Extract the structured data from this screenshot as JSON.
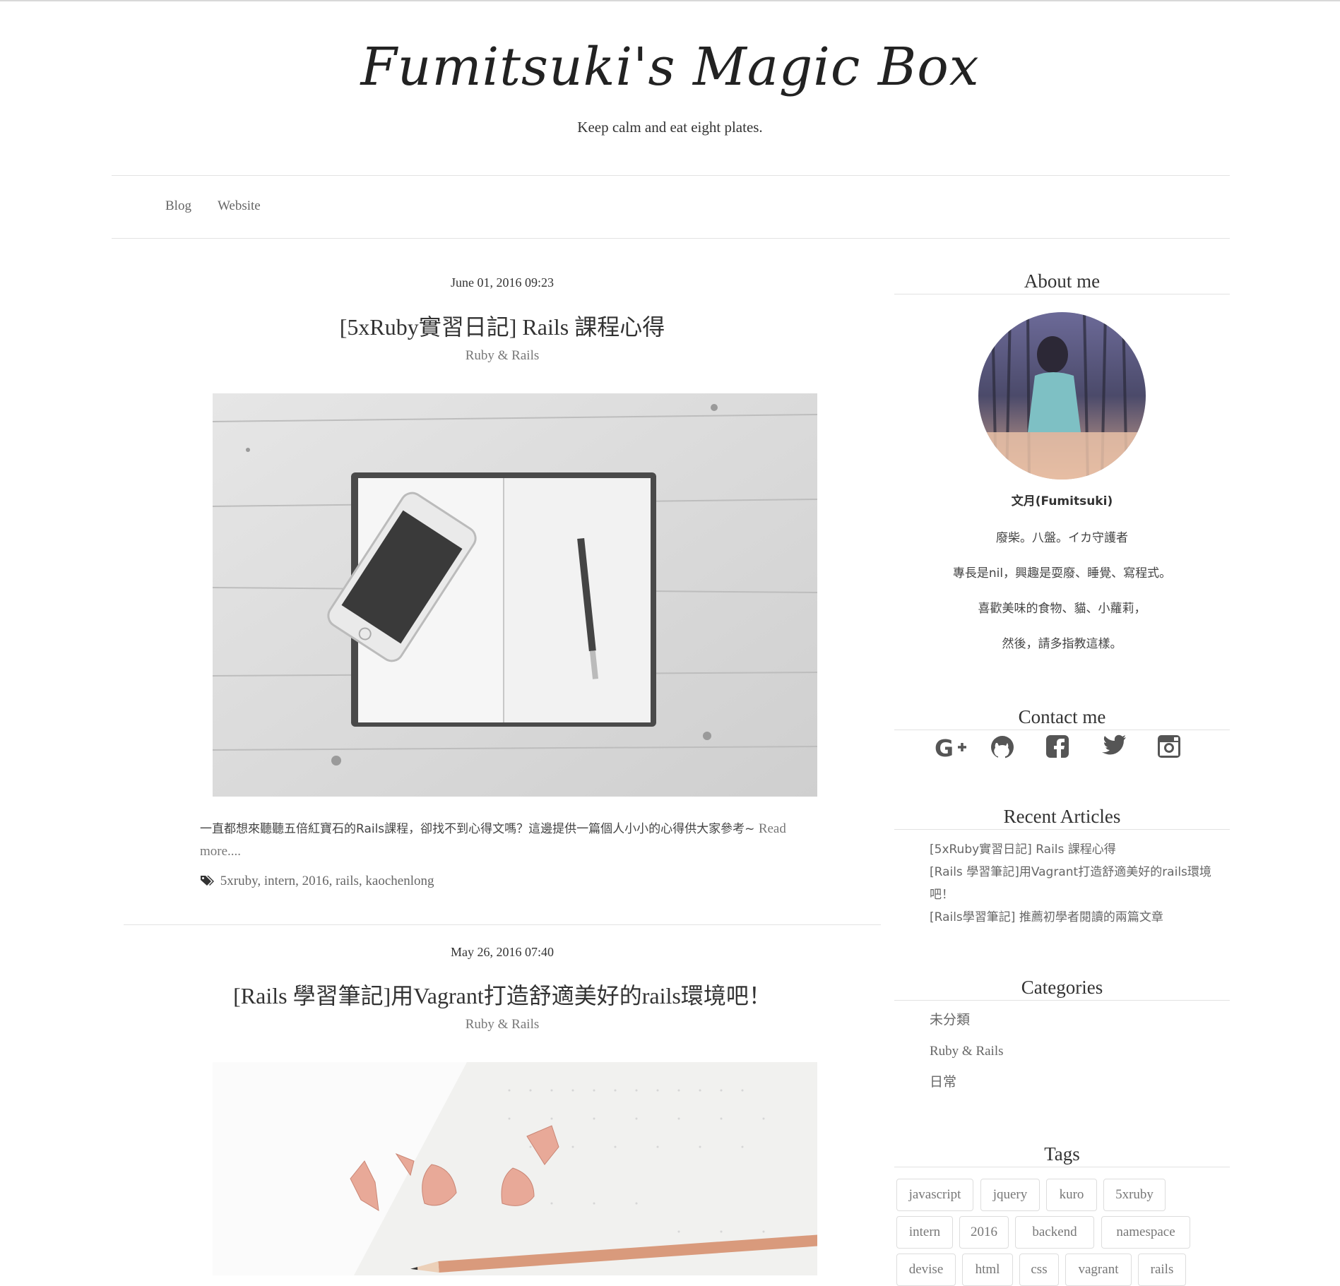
{
  "site": {
    "title": "Fumitsuki's Magic Box",
    "subtitle": "Keep calm and eat eight plates."
  },
  "nav": {
    "items": [
      {
        "label": "Blog"
      },
      {
        "label": "Website"
      }
    ]
  },
  "posts": [
    {
      "date": "June 01, 2016 09:23",
      "title": "[5xRuby實習日記] Rails 課程心得",
      "category": "Ruby & Rails",
      "excerpt_text": "一直都想來聽聽五倍紅寶石的Rails課程，卻找不到心得文嗎？這邊提供一篇個人小小的心得供大家參考~ ",
      "excerpt_more": "Read more....",
      "tags": [
        "5xruby",
        "intern",
        "2016",
        "rails",
        "kaochenlong"
      ]
    },
    {
      "date": "May 26, 2016 07:40",
      "title": "[Rails 學習筆記]用Vagrant打造舒適美好的rails環境吧！",
      "category": "Ruby & Rails"
    }
  ],
  "sidebar": {
    "about": {
      "title": "About me",
      "name": "文月(Fumitsuki)",
      "lines": [
        "廢柴。八盤。イカ守護者",
        "專長是nil，興趣是耍廢、睡覺、寫程式。",
        "喜歡美味的食物、貓、小蘿莉，",
        "然後，請多指教這樣。"
      ]
    },
    "contact": {
      "title": "Contact me",
      "icons": [
        "google-plus-icon",
        "github-icon",
        "facebook-icon",
        "twitter-icon",
        "instagram-icon"
      ]
    },
    "recent": {
      "title": "Recent Articles",
      "items": [
        "[5xRuby實習日記] Rails 課程心得",
        "[Rails 學習筆記]用Vagrant打造舒適美好的rails環境吧！",
        "[Rails學習筆記] 推薦初學者閱讀的兩篇文章"
      ]
    },
    "categories": {
      "title": "Categories",
      "items": [
        "未分類",
        "Ruby & Rails",
        "日常"
      ]
    },
    "tags": {
      "title": "Tags",
      "items": [
        "javascript",
        "jquery",
        "kuro",
        "5xruby",
        "intern",
        "2016",
        "backend",
        "namespace",
        "devise",
        "html",
        "css",
        "vagrant",
        "rails"
      ]
    }
  },
  "colors": {
    "text": "#333333",
    "muted": "#777777",
    "divider": "#e2e2e2",
    "icon": "#555555"
  }
}
